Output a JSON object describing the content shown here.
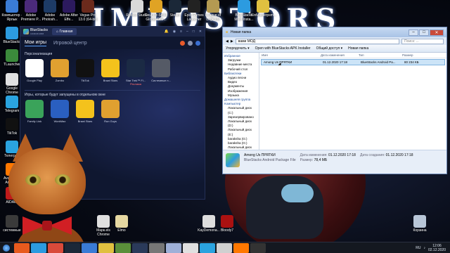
{
  "wallpaper": {
    "title": "IMPOSTORS"
  },
  "desktop_icons": [
    {
      "label": "Компьютер · Ярлык",
      "color": "#3a7bd5"
    },
    {
      "label": "Adobe Premiere P...",
      "color": "#4b2a7a"
    },
    {
      "label": "Adobe Photosh...",
      "color": "#1d3b66"
    },
    {
      "label": "Adobe After Effe...",
      "color": "#2c1a5e"
    },
    {
      "label": "Vegas Pro 13.0 (64-bit)",
      "color": "#6b2a1c"
    },
    {
      "label": "Roblox Studio",
      "color": "#d9d9d9"
    },
    {
      "label": "Counter-Strike Global Offe...",
      "color": "#e0a324"
    },
    {
      "label": "Steam",
      "color": "#1b2838"
    },
    {
      "label": "Epic Games Launcher",
      "color": "#222"
    },
    {
      "label": "League of Legends",
      "color": "#b49a52"
    },
    {
      "label": "BlueStacks Multi-Insta...",
      "color": "#2c9be0"
    },
    {
      "label": "KinMasterpsm...",
      "color": "#e0c040"
    },
    {
      "label": "BlueStacks",
      "color": "#2c9be0"
    },
    {
      "label": "TLauncher",
      "color": "#3b8a3b"
    },
    {
      "label": "Google Chrome",
      "color": "#e0e0e0"
    },
    {
      "label": "Telegram",
      "color": "#2aa3df"
    },
    {
      "label": "TikTok",
      "color": "#111"
    },
    {
      "label": "Телеграм",
      "color": "#2aa3df"
    },
    {
      "label": "Avast Free Antivirus",
      "color": "#ff7800"
    },
    {
      "label": "AIDA64",
      "color": "#c01a1a"
    },
    {
      "label": "системные",
      "color": "#3a3a3a"
    },
    {
      "label": "Mapк.els Chrome",
      "color": "#e0e0e0"
    },
    {
      "label": "Elmo",
      "color": "#e6d8a2"
    },
    {
      "label": "KayDemona...",
      "color": "#ddd"
    },
    {
      "label": "Bloody7",
      "color": "#aa1111"
    },
    {
      "label": "Корзина",
      "color": "#b8c6d8"
    }
  ],
  "bluestacks": {
    "brand": "BlueStacks",
    "version": "4.240.20.1016",
    "tab": "Главная",
    "nav": {
      "my_games": "Мои игры",
      "game_center": "Игровой центр"
    },
    "section_personal": "Персонализация",
    "personal_apps": [
      {
        "label": "Google Play",
        "color": "#ffffff"
      },
      {
        "label": "Zombo",
        "color": "#e0a030"
      },
      {
        "label": "TikTok",
        "color": "#111111"
      },
      {
        "label": "Brawl Stars",
        "color": "#f4c21c"
      },
      {
        "label": "Star Trek™ Fl...",
        "color": "#1b2a44",
        "badge": "Реклама"
      },
      {
        "label": "Системные п...",
        "color": "#555a66"
      }
    ],
    "section_separate": "Игры, которые будут запущены в отдельном окне",
    "separate_apps": [
      {
        "label": "Family Link",
        "color": "#3aa35a"
      },
      {
        "label": "WorkMax",
        "color": "#2a5fc0"
      },
      {
        "label": "Brawl Stars",
        "color": "#f4c21c"
      },
      {
        "label": "Run Guys",
        "color": "#e0a030"
      }
    ]
  },
  "explorer": {
    "title": "Новая папка",
    "address": "вами МОД",
    "search_placeholder": "Поиск: ...",
    "toolbar": [
      "Упорядочить ▾",
      "Open with BlueStacks APK Installer",
      "Общий доступ ▾",
      "Новая папка"
    ],
    "sidebar": [
      {
        "label": "Избранное",
        "group": true
      },
      {
        "label": "Загрузки",
        "group": false
      },
      {
        "label": "Недавние места",
        "group": false
      },
      {
        "label": "Рабочий стол",
        "group": false
      },
      {
        "label": "Библиотеки",
        "group": true
      },
      {
        "label": "Аудио песни",
        "group": false
      },
      {
        "label": "Видео",
        "group": false
      },
      {
        "label": "Документы",
        "group": false
      },
      {
        "label": "Изображения",
        "group": false
      },
      {
        "label": "Музыка",
        "group": false
      },
      {
        "label": "Домашняя группа",
        "group": true
      },
      {
        "label": "Компьютер",
        "group": true
      },
      {
        "label": "Локальный диск (C:)",
        "group": false
      },
      {
        "label": "Зарезервировано",
        "group": false
      },
      {
        "label": "Локальный диск (D:)",
        "group": false
      },
      {
        "label": "Локальный диск (E:)",
        "group": false
      },
      {
        "label": "baraksha (G:)",
        "group": false
      },
      {
        "label": "baraksha (G:)",
        "group": false
      },
      {
        "label": "Локальный диск",
        "group": false
      },
      {
        "label": "Локальный диск",
        "group": false
      }
    ],
    "columns": [
      "Имя",
      "Дата изменения",
      "Тип",
      "Размер"
    ],
    "files": [
      {
        "name": "Among Us ПРЯТКИ",
        "date": "01.12.2020 17:18",
        "type": "BlueStacks Android Pa...",
        "size": "80 234 КБ"
      }
    ],
    "status": {
      "name": "Among Us ПРЯТКИ",
      "type": "BlueStacks Android Package File",
      "modified_label": "Дата изменения:",
      "modified": "01.12.2020 17:18",
      "size_label": "Размер:",
      "size": "78,4 МБ",
      "created_label": "Дата создания:",
      "created": "01.12.2020 17:18"
    }
  },
  "taskbar": {
    "lang": "RU",
    "time": "12:06",
    "date": "02.12.2020"
  }
}
